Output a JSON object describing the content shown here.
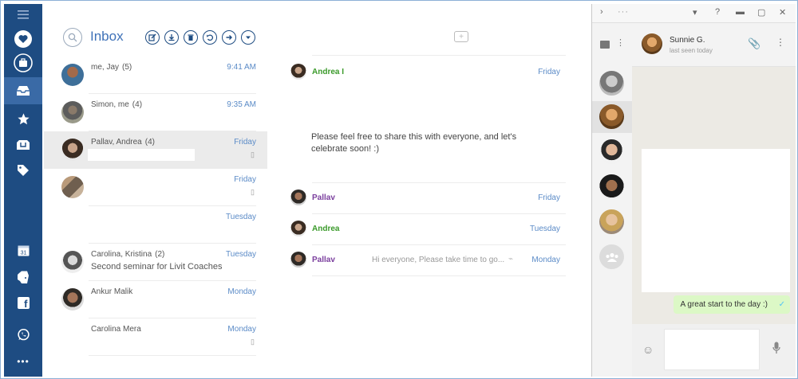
{
  "nav": {
    "items": [
      {
        "name": "menu-icon"
      },
      {
        "name": "heart-icon"
      },
      {
        "name": "briefcase-icon"
      },
      {
        "name": "inbox-tray-icon"
      },
      {
        "name": "star-icon"
      },
      {
        "name": "folder-icon"
      },
      {
        "name": "tag-icon"
      },
      {
        "name": "calendar-icon",
        "label": "31"
      },
      {
        "name": "evernote-icon"
      },
      {
        "name": "facebook-icon",
        "label": "f"
      },
      {
        "name": "whatsapp-icon"
      },
      {
        "name": "more-icon",
        "label": "•••"
      }
    ]
  },
  "list": {
    "title": "Inbox",
    "toolbar": [
      "compose-icon",
      "download-icon",
      "trash-icon",
      "undo-icon",
      "forward-icon",
      "dropdown-icon"
    ],
    "rows": [
      {
        "sender": "me, Jay",
        "count": "(5)",
        "time": "9:41 AM",
        "subject": ""
      },
      {
        "sender": "Simon, me",
        "count": "(4)",
        "time": "9:35 AM",
        "subject": ""
      },
      {
        "sender": "Pallav, Andrea",
        "count": "(4)",
        "time": "Friday",
        "subject": ""
      },
      {
        "sender": "",
        "count": "",
        "time": "Friday",
        "subject": ""
      },
      {
        "sender": "",
        "count": "",
        "time": "Tuesday",
        "subject": ""
      },
      {
        "sender": "Carolina, Kristina",
        "count": "(2)",
        "time": "Tuesday",
        "subject": "Second seminar for Livit Coaches"
      },
      {
        "sender": "Ankur Malik",
        "count": "",
        "time": "Monday",
        "subject": ""
      },
      {
        "sender": "Carolina Mera",
        "count": "",
        "time": "Monday",
        "subject": ""
      }
    ]
  },
  "thread": {
    "messages": [
      {
        "name": "Andrea I",
        "date": "Friday",
        "color": "#3a9a2a",
        "preview": ""
      },
      {
        "name": "Pallav",
        "date": "Friday",
        "color": "#7b3f9e",
        "preview": ""
      },
      {
        "name": "Andrea",
        "date": "Tuesday",
        "color": "#3a9a2a",
        "preview": ""
      },
      {
        "name": "Pallav",
        "date": "Monday",
        "color": "#7b3f9e",
        "preview": "Hi everyone, Please take time to go..."
      }
    ],
    "body": "Please feel free to share this with everyone, and let's celebrate soon! :)"
  },
  "chat": {
    "contact_name": "Sunnie G.",
    "status": "last seen today",
    "bubble_text": "A great start to the day :)",
    "titlebar_help": "?"
  },
  "colors": {
    "nav_bg": "#1e4c82",
    "accent_blue": "#5b8bc7",
    "chat_bubble": "#dcf8c6"
  }
}
